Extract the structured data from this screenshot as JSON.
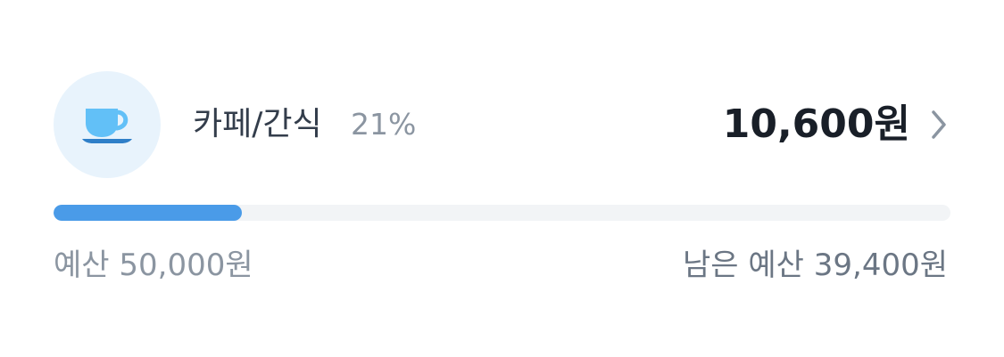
{
  "category": {
    "icon": "coffee-cup-icon",
    "name": "카페/간식",
    "percent_text": "21%",
    "amount_text": "10,600원"
  },
  "progress": {
    "fraction": 0.21,
    "fill_color": "#4a9be8",
    "track_color": "#f2f4f6"
  },
  "budget": {
    "total_text": "예산 50,000원",
    "remaining_text": "남은 예산 39,400원"
  },
  "colors": {
    "icon_background": "#e8f3fc",
    "icon_color": "#62c0f7"
  }
}
